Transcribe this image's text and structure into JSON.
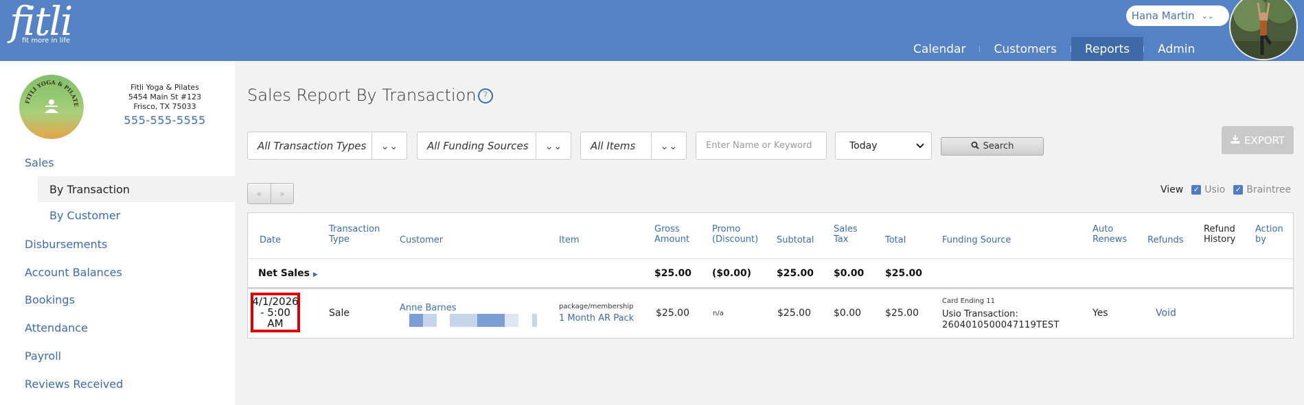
{
  "brand": {
    "logo_text": "fitli",
    "tagline": "fit more in life"
  },
  "user": {
    "name": "Hana Martin"
  },
  "nav": {
    "items": [
      "Calendar",
      "Customers",
      "Reports",
      "Admin"
    ],
    "active": "Reports"
  },
  "studio": {
    "name": "Fitli Yoga & Pilates",
    "address1": "5454 Main St #123",
    "address2": "Frisco, TX 75033",
    "phone": "555-555-5555",
    "logo_text": "FITLI YOGA & PILATES"
  },
  "sidebar": {
    "sales": "Sales",
    "sales_items": [
      "By Transaction",
      "By Customer"
    ],
    "items": [
      "Disbursements",
      "Account Balances",
      "Bookings",
      "Attendance",
      "Payroll",
      "Reviews Received"
    ]
  },
  "page": {
    "title": "Sales Report By Transaction",
    "help_icon": "?"
  },
  "filters": {
    "transaction_types": "All Transaction Types",
    "funding_sources": "All Funding Sources",
    "items": "All Items",
    "keyword_placeholder": "Enter Name or Keyword",
    "date_range": "Today",
    "search_label": "Search",
    "export_label": "EXPORT"
  },
  "pager": {
    "prev": "«",
    "next": "»"
  },
  "view": {
    "label": "View",
    "options": [
      "Usio",
      "Braintree"
    ]
  },
  "table": {
    "headers": {
      "date": "Date",
      "type_1": "Transaction",
      "type_2": "Type",
      "customer": "Customer",
      "item": "Item",
      "gross_1": "Gross",
      "gross_2": "Amount",
      "promo_1": "Promo",
      "promo_2": "(Discount)",
      "subtotal": "Subtotal",
      "tax_1": "Sales",
      "tax_2": "Tax",
      "total": "Total",
      "funding": "Funding Source",
      "auto_1": "Auto",
      "auto_2": "Renews",
      "refunds": "Refunds",
      "history_1": "Refund",
      "history_2": "History",
      "action_1": "Action",
      "action_2": "by"
    },
    "net_sales": {
      "label": "Net Sales",
      "gross": "$25.00",
      "promo": "($0.00)",
      "subtotal": "$25.00",
      "tax": "$0.00",
      "total": "$25.00"
    },
    "rows": [
      {
        "date_1": "4/1/2026",
        "date_2": "- 5:00 AM",
        "type": "Sale",
        "customer": "Anne Barnes",
        "item_kind": "package/membership",
        "item_name": "1 Month AR Pack",
        "gross": "$25.00",
        "promo": "n/a",
        "subtotal": "$25.00",
        "tax": "$0.00",
        "total": "$25.00",
        "card": "Card Ending 11",
        "funding_1": "Usio Transaction:",
        "funding_2": "2604010500047119TEST",
        "auto_renews": "Yes",
        "refund_action": "Void"
      }
    ]
  },
  "colors": {
    "header": "#5482c4",
    "accent": "#3c6bb0",
    "highlight": "#e00000"
  }
}
